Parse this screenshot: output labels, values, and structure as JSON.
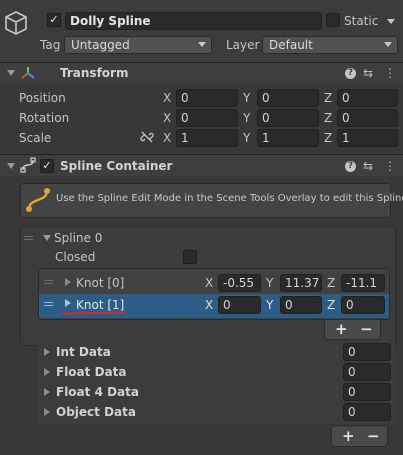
{
  "header": {
    "object_name": "Dolly Spline",
    "static_label": "Static",
    "tag_label": "Tag",
    "tag_value": "Untagged",
    "layer_label": "Layer",
    "layer_value": "Default"
  },
  "transform": {
    "title": "Transform",
    "rows": [
      {
        "label": "Position",
        "x": "0",
        "y": "0",
        "z": "0"
      },
      {
        "label": "Rotation",
        "x": "0",
        "y": "0",
        "z": "0"
      },
      {
        "label": "Scale",
        "x": "1",
        "y": "1",
        "z": "1"
      }
    ],
    "axis_x": "X",
    "axis_y": "Y",
    "axis_z": "Z"
  },
  "spline_container": {
    "title": "Spline Container",
    "info_text": "Use the Spline Edit Mode in the Scene Tools Overlay to edit this Spline.",
    "spline_label": "Spline 0",
    "closed_label": "Closed",
    "knots": [
      {
        "label": "Knot [0]",
        "x": "-0.55",
        "y": "11.37",
        "z": "-11.1",
        "selected": false
      },
      {
        "label": "Knot [1]",
        "x": "0",
        "y": "0",
        "z": "0",
        "selected": true
      }
    ],
    "data_sections": [
      {
        "label": "Int Data",
        "value": "0"
      },
      {
        "label": "Float Data",
        "value": "0"
      },
      {
        "label": "Float 4 Data",
        "value": "0"
      },
      {
        "label": "Object Data",
        "value": "0"
      }
    ],
    "plus": "+",
    "minus": "−"
  },
  "colors": {
    "background": "#383838",
    "selected_row": "#2c5d87",
    "underline": "#e0262d",
    "spline_icon": "#e8a23a"
  },
  "icons": [
    "cube-icon",
    "transform-axes-icon",
    "spline-icon",
    "help-icon",
    "presets-icon",
    "more-icon",
    "link-scale-icon"
  ]
}
